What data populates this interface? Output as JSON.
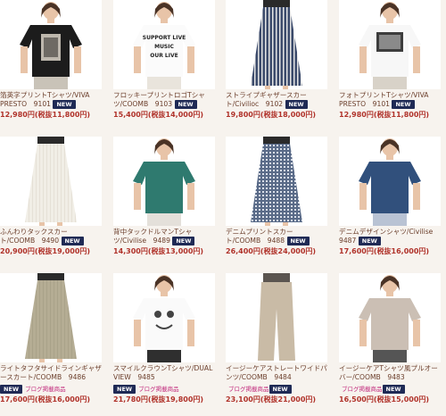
{
  "new_badge": "NEW",
  "blog_label": "ブログ掲載商品",
  "products": [
    {
      "name1": "箔英字プリントTシャツ/VIVA",
      "name2": "PRESTO　9101",
      "price": "12,980円",
      "tax": "(税抜11,800円)",
      "badge": true,
      "blog": false
    },
    {
      "name1": "フロッキープリントロゴTシャ",
      "name2": "ツ/COOMB　9103",
      "price": "15,400円",
      "tax": "(税抜14,000円)",
      "badge": true,
      "blog": false
    },
    {
      "name1": "ストライプギャザースカー",
      "name2": "ト/Civilioc　9102",
      "price": "19,800円",
      "tax": "(税抜18,000円)",
      "badge": true,
      "blog": false
    },
    {
      "name1": "フォトプリントTシャツ/VIVA",
      "name2": "PRESTO　9101",
      "price": "12,980円",
      "tax": "(税抜11,800円)",
      "badge": true,
      "blog": false
    },
    {
      "name1": "ふんわりタックスカー",
      "name2": "ト/COOMB　9490",
      "price": "20,900円",
      "tax": "(税抜19,000円)",
      "badge": true,
      "blog": false
    },
    {
      "name1": "背中タックドルマンTシャ",
      "name2": "ツ/Civilise　9489",
      "price": "14,300円",
      "tax": "(税抜13,000円)",
      "badge": true,
      "blog": false
    },
    {
      "name1": "デニムプリントスカー",
      "name2": "ト/COOMB　9488",
      "price": "26,400円",
      "tax": "(税抜24,000円)",
      "badge": true,
      "blog": false
    },
    {
      "name1": "デニムデザインシャツ/Civilise",
      "name2": "9487",
      "price": "17,600円",
      "tax": "(税抜16,000円)",
      "badge": true,
      "blog": false
    },
    {
      "name1": "ライトタフタサイドラインギャザ",
      "name2": "ースカート/COOMB　9486",
      "price": "17,600円",
      "tax": "(税抜16,000円)",
      "badge": true,
      "blog": true
    },
    {
      "name1": "スマイルクラウンTシャツ/DUAL",
      "name2": "VIEW　9485",
      "price": "21,780円",
      "tax": "(税抜19,800円)",
      "badge": true,
      "blog": true
    },
    {
      "name1": "イージーケアストレートワイドパ",
      "name2": "ンツ/COOMB　9484",
      "price": "23,100円",
      "tax": "(税抜21,000円)",
      "badge": true,
      "blog": true
    },
    {
      "name1": "イージーケアTシャツ風プルオー",
      "name2": "バー/COOMB　9483",
      "price": "16,500円",
      "tax": "(税抜15,000円)",
      "badge": true,
      "blog": true
    }
  ],
  "print_texts": {
    "shirt2": "SUPPORT LIVE MUSIC OUR LIVE"
  }
}
